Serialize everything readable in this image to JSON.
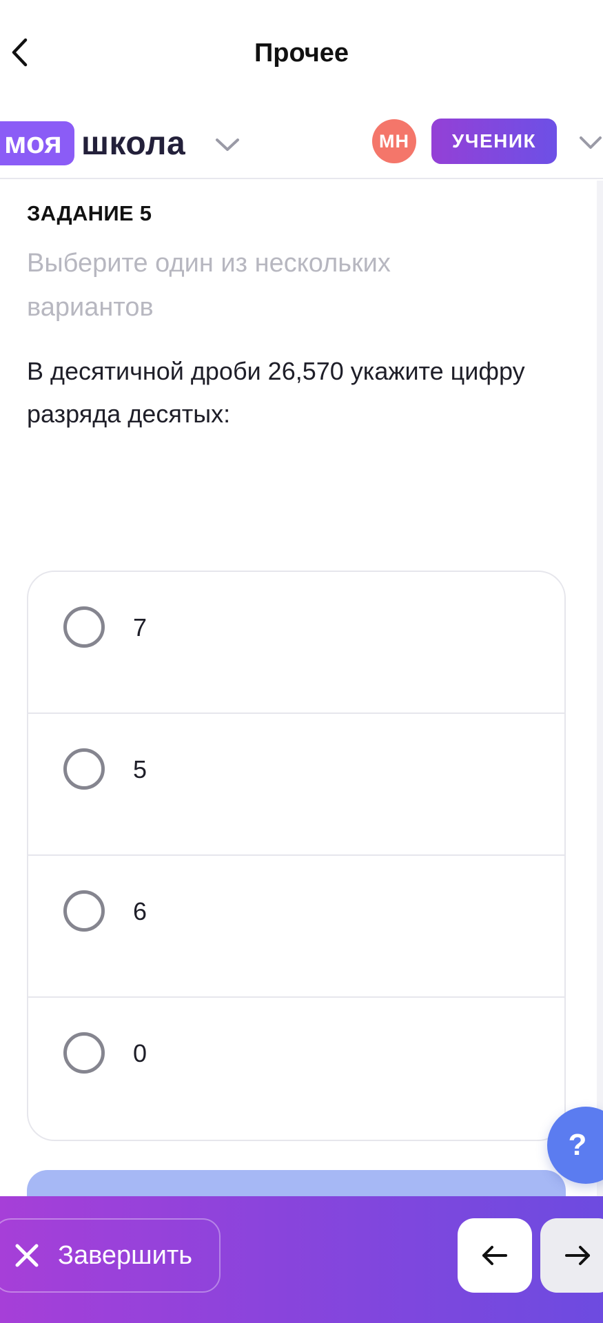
{
  "nav": {
    "title": "Прочее",
    "back_icon": "chevron-left-icon"
  },
  "header": {
    "logo_part1": "моя",
    "logo_part2": "школа",
    "avatar_initials": "МН",
    "role_label": "УЧЕНИК",
    "brand_color": "#8b5cf6",
    "avatar_color": "#f4766a"
  },
  "task": {
    "label": "ЗАДАНИЕ 5",
    "hint": "Выберите один из нескольких вариантов",
    "question": "В десятичной дроби 26,570 укажите цифру разряда десятых:"
  },
  "options": [
    {
      "text": "7",
      "selected": false
    },
    {
      "text": "5",
      "selected": false
    },
    {
      "text": "6",
      "selected": false
    },
    {
      "text": "0",
      "selected": false
    }
  ],
  "help": {
    "label": "?"
  },
  "bottom": {
    "finish_label": "Завершить",
    "prev_icon": "arrow-left-icon",
    "next_icon": "arrow-right-icon"
  }
}
